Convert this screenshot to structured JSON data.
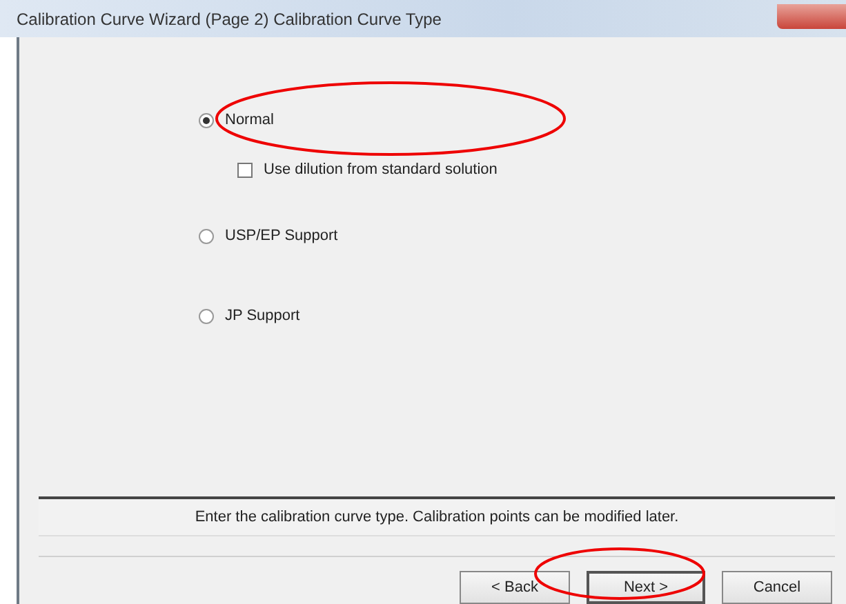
{
  "window": {
    "title": "Calibration Curve Wizard (Page 2) Calibration Curve Type"
  },
  "options": [
    {
      "kind": "radio",
      "label": "Normal",
      "selected": true
    },
    {
      "kind": "checkbox",
      "label": "Use dilution from standard solution",
      "checked": false
    },
    {
      "kind": "radio",
      "label": "USP/EP Support",
      "selected": false
    },
    {
      "kind": "radio",
      "label": "JP Support",
      "selected": false
    }
  ],
  "message": "Enter the calibration curve type. Calibration points can be modified later.",
  "buttons": [
    {
      "label": "< Back",
      "default": false
    },
    {
      "label": "Next >",
      "default": true
    },
    {
      "label": "Cancel",
      "default": false
    }
  ]
}
